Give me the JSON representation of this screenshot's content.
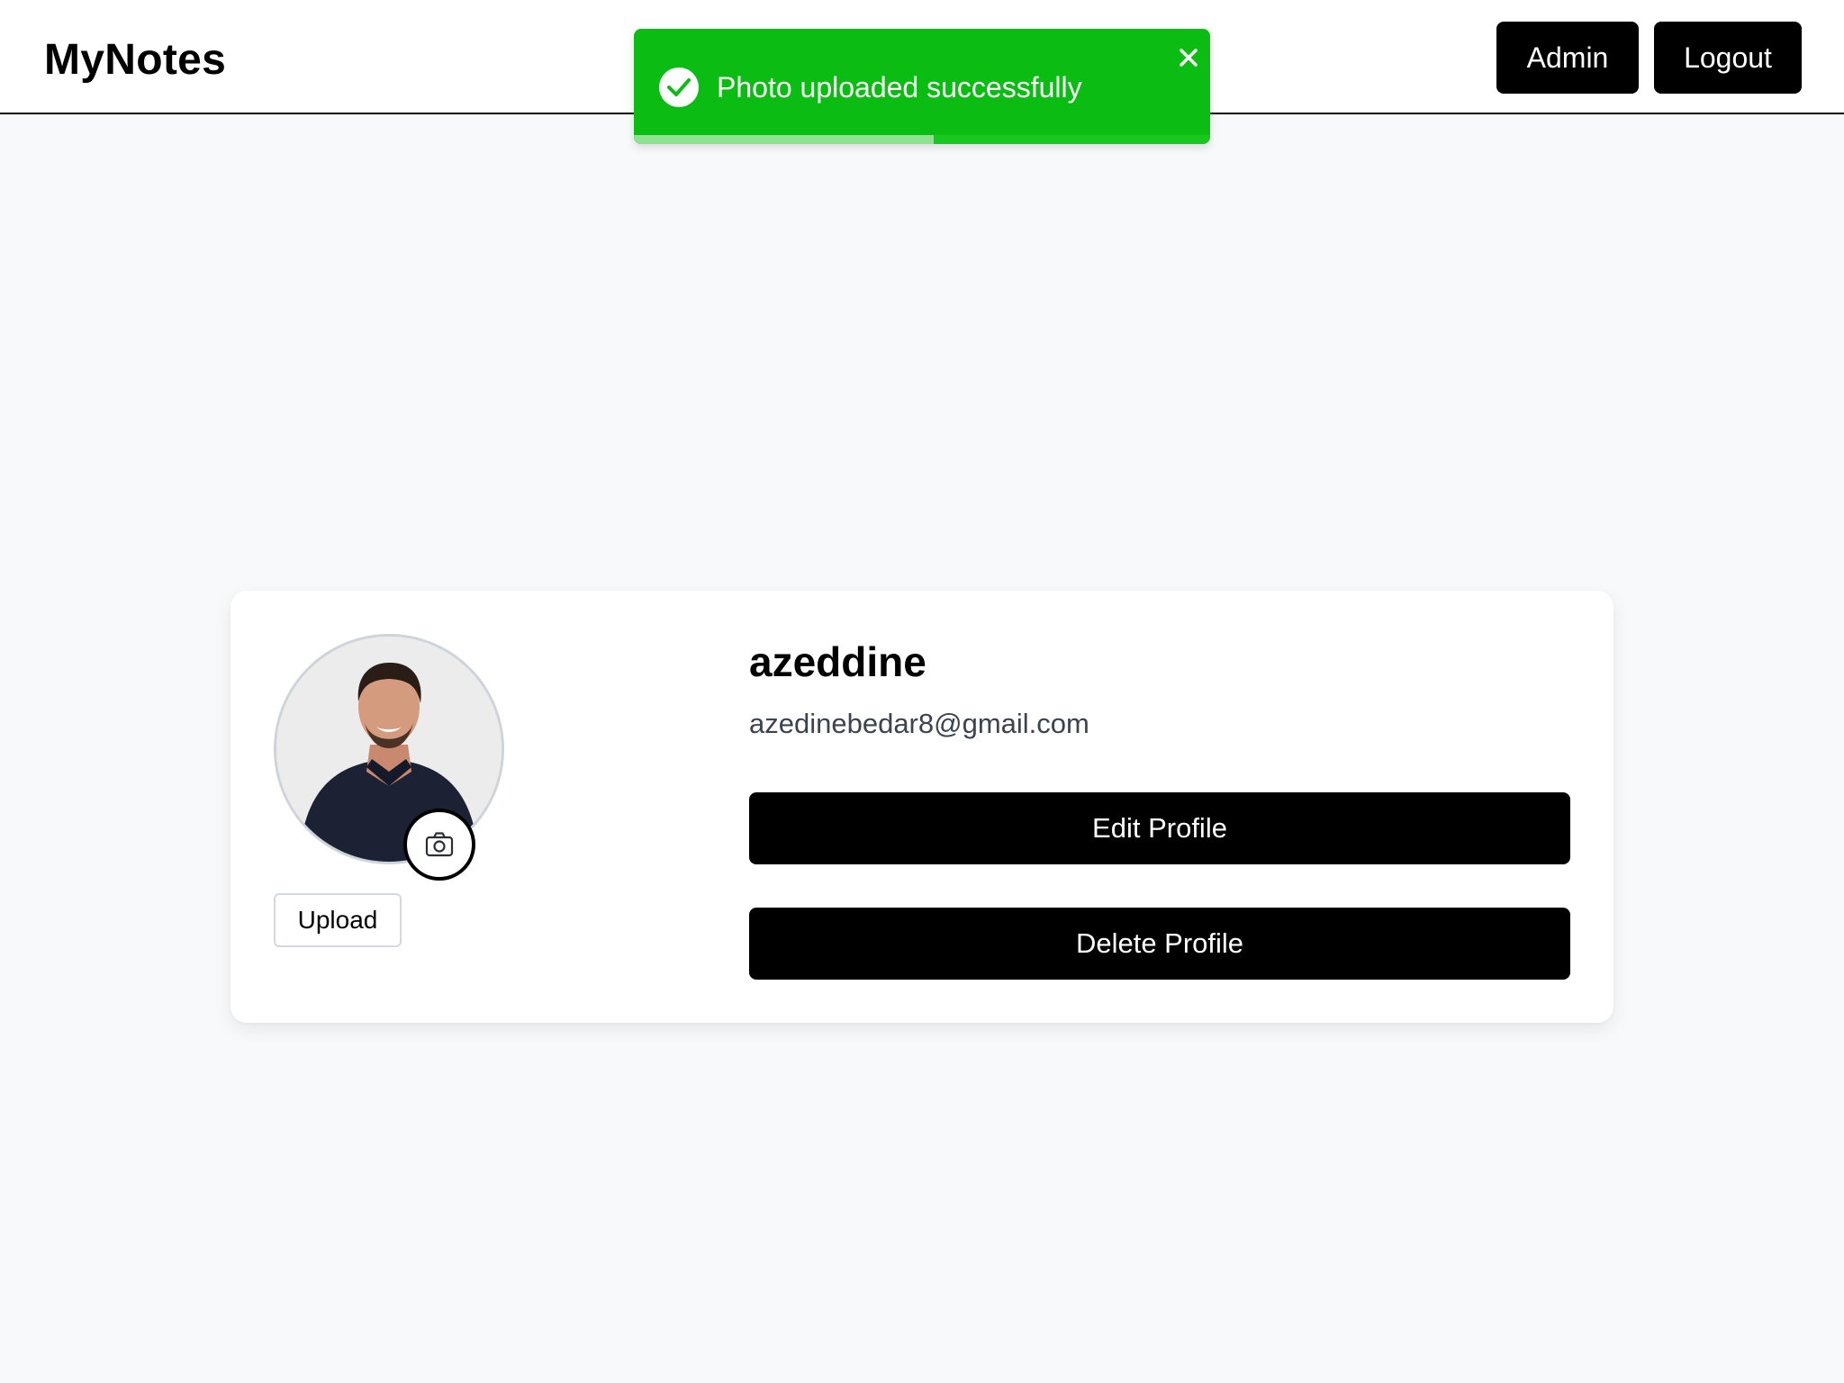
{
  "header": {
    "brand": "MyNotes",
    "admin_label": "Admin",
    "logout_label": "Logout"
  },
  "toast": {
    "message": "Photo uploaded successfully",
    "status": "success",
    "color": "#0bbd12",
    "icons": [
      "check-circle-icon",
      "close-icon"
    ],
    "progress_remaining": 0.52
  },
  "profile": {
    "name": "azeddine",
    "email": "azedinebedar8@gmail.com",
    "upload_label": "Upload",
    "edit_label": "Edit Profile",
    "delete_label": "Delete Profile",
    "avatar_icon": "camera-icon"
  },
  "colors": {
    "page_background": "#f8f9fb",
    "primary_button": "#000000",
    "toast_background": "#0bbd12"
  }
}
